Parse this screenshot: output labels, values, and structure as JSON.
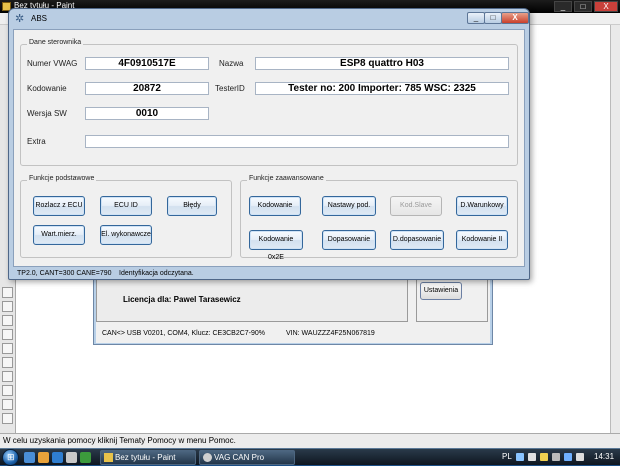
{
  "paint": {
    "title": "Bez tytułu - Paint",
    "window_buttons": {
      "minimize": "_",
      "maximize": "□",
      "close": "X"
    },
    "status": "W celu uzyskania pomocy kliknij Tematy Pomocy w menu Pomoc."
  },
  "vag_main": {
    "license": "Licencja dla: Pawel Tarasewicz",
    "ustawienia_label": "Ustawienia",
    "status_connection": "CAN<> USB V0201, COM4, Klucz: CE3CB2C7-90%",
    "status_vin": "VIN: WAUZZZ4F25N067819"
  },
  "abs_window": {
    "title": "ABS",
    "window_buttons": {
      "minimize": "_",
      "maximize": "□",
      "close": "X"
    },
    "controller_group": {
      "label": "Dane sterownika",
      "fields": {
        "numer_vwag": {
          "label": "Numer VWAG",
          "value": "4F0910517E"
        },
        "nazwa": {
          "label": "Nazwa",
          "value": "ESP8 quattro    H03"
        },
        "kodowanie": {
          "label": "Kodowanie",
          "value": "20872"
        },
        "testerid": {
          "label": "TesterID",
          "value": "Tester no: 200 Importer: 785 WSC: 2325"
        },
        "wersja_sw": {
          "label": "Wersja SW",
          "value": "0010"
        },
        "extra": {
          "label": "Extra",
          "value": ""
        }
      }
    },
    "basic_group": {
      "label": "Funkcje podstawowe",
      "buttons": [
        "Rozlacz z ECU",
        "ECU ID",
        "Błędy",
        "Wart.mierz.",
        "El. wykonawcze"
      ]
    },
    "advanced_group": {
      "label": "Funkcje zaawansowane",
      "buttons": [
        "Kodowanie",
        "Nastawy pod.",
        "Kod.Slave",
        "D.Warunkowy",
        "Kodowanie 0x2E",
        "Dopasowanie",
        "D.dopasowanie",
        "Kodowanie II"
      ],
      "disabled": [
        "Kod.Slave"
      ]
    },
    "status": {
      "protocol": "TP2.0, CANT=300 CANE=790",
      "message": "Identyfikacja odczytana."
    }
  },
  "taskbar": {
    "tasks": [
      "Bez tytułu - Paint",
      "VAG CAN Pro"
    ],
    "language": "PL",
    "time": "14:31"
  },
  "colors": {
    "dialog_frame": "#b9cde3",
    "button_border": "#34679b",
    "close_red": "#c9402c",
    "taskbar": "#1b2a3a"
  }
}
